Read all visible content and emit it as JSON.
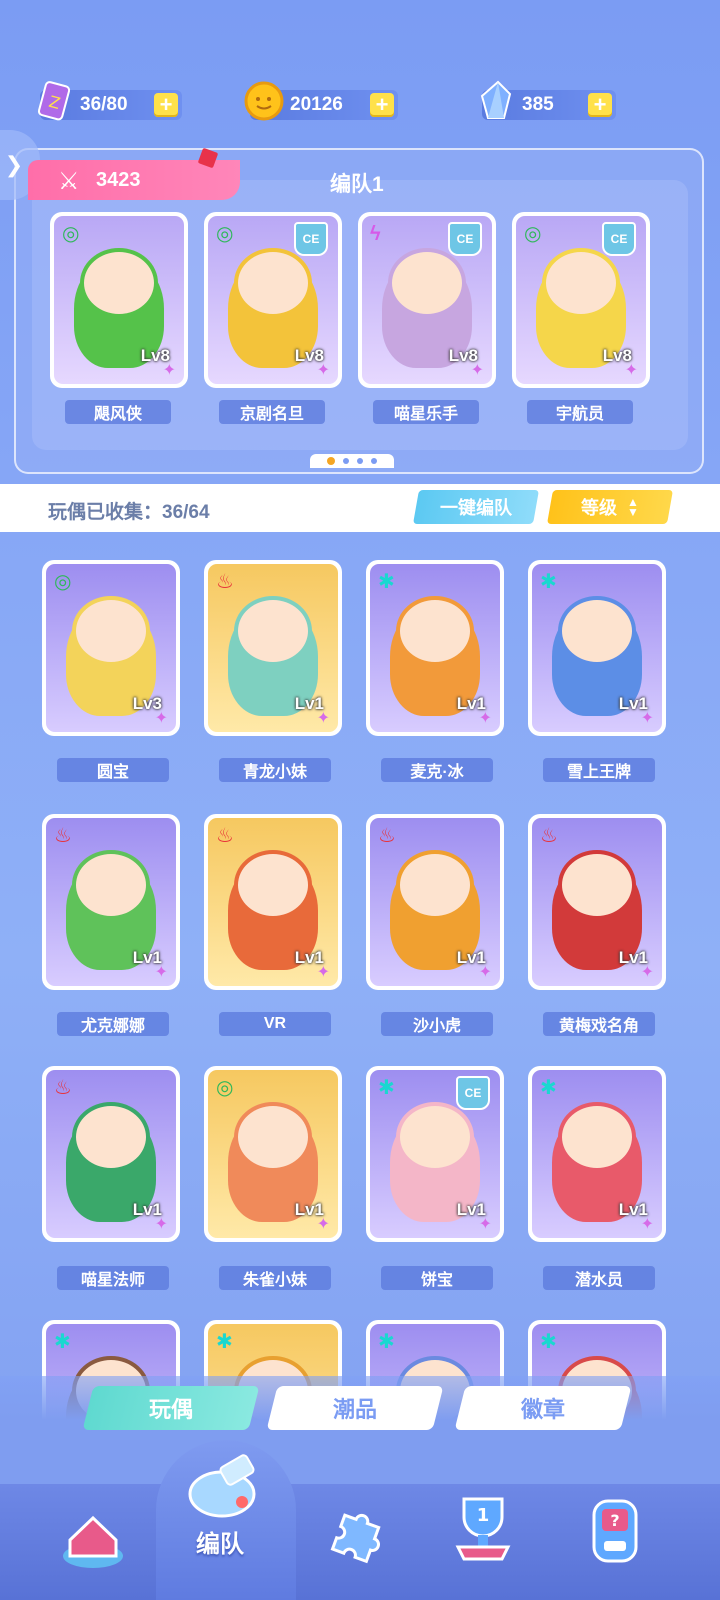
{
  "resources": {
    "stamina": {
      "value": "36/80",
      "icon": "energy-ticket-icon"
    },
    "coins": {
      "value": "20126",
      "icon": "coin-icon"
    },
    "gems": {
      "value": "385",
      "icon": "crystal-icon"
    }
  },
  "team": {
    "power": "3423",
    "title": "编队1",
    "members": [
      {
        "name": "飓风侠",
        "level": "Lv8",
        "element": "wind",
        "ce": false,
        "color": "#55c24a"
      },
      {
        "name": "京剧名旦",
        "level": "Lv8",
        "element": "wind",
        "ce": true,
        "color": "#f3c33a"
      },
      {
        "name": "喵星乐手",
        "level": "Lv8",
        "element": "thunder",
        "ce": true,
        "color": "#c7a6e0"
      },
      {
        "name": "宇航员",
        "level": "Lv8",
        "element": "wind",
        "ce": true,
        "color": "#f5d64a"
      }
    ],
    "page_count": 4,
    "active_page": 1
  },
  "collection": {
    "label": "玩偶已收集：36/64",
    "one_click_label": "一键编队",
    "sort_label": "等级"
  },
  "dolls": [
    {
      "name": "圆宝",
      "level": "Lv3",
      "element": "wind",
      "ce": false,
      "color": "#f3d35a"
    },
    {
      "name": "青龙小妹",
      "level": "Lv1",
      "element": "fire",
      "ce": false,
      "color": "#7ed0c0"
    },
    {
      "name": "麦克·冰",
      "level": "Lv1",
      "element": "ice",
      "ce": false,
      "color": "#f29a3a"
    },
    {
      "name": "雪上王牌",
      "level": "Lv1",
      "element": "ice",
      "ce": false,
      "color": "#5c8ee6"
    },
    {
      "name": "尤克娜娜",
      "level": "Lv1",
      "element": "fire",
      "ce": false,
      "color": "#5fc25a"
    },
    {
      "name": "VR",
      "level": "Lv1",
      "element": "fire",
      "ce": false,
      "color": "#e86a3a"
    },
    {
      "name": "沙小虎",
      "level": "Lv1",
      "element": "fire",
      "ce": false,
      "color": "#f0a030"
    },
    {
      "name": "黄梅戏名角",
      "level": "Lv1",
      "element": "fire",
      "ce": false,
      "color": "#d23a3a"
    },
    {
      "name": "喵星法师",
      "level": "Lv1",
      "element": "fire",
      "ce": false,
      "color": "#3aa86a"
    },
    {
      "name": "朱雀小妹",
      "level": "Lv1",
      "element": "wind",
      "ce": false,
      "color": "#f08a5a"
    },
    {
      "name": "饼宝",
      "level": "Lv1",
      "element": "ice",
      "ce": true,
      "color": "#f4b6c8"
    },
    {
      "name": "潜水员",
      "level": "Lv1",
      "element": "ice",
      "ce": false,
      "color": "#e85a6a"
    },
    {
      "name": "",
      "level": "",
      "element": "ice",
      "ce": false,
      "color": "#8a5a40"
    },
    {
      "name": "",
      "level": "",
      "element": "ice",
      "ce": false,
      "color": "#e8a030"
    },
    {
      "name": "",
      "level": "",
      "element": "ice",
      "ce": false,
      "color": "#6a8ae0"
    },
    {
      "name": "",
      "level": "",
      "element": "ice",
      "ce": false,
      "color": "#d84a4a"
    }
  ],
  "tabs": [
    {
      "label": "玩偶",
      "active": true
    },
    {
      "label": "潮品",
      "active": false
    },
    {
      "label": "徽章",
      "active": false
    }
  ],
  "nav": {
    "items": [
      {
        "icon": "home-icon"
      },
      {
        "icon": "team-whistle-icon",
        "label": "编队"
      },
      {
        "icon": "puzzle-icon"
      },
      {
        "icon": "trophy-icon"
      },
      {
        "icon": "gacha-machine-icon"
      }
    ]
  },
  "ce_badge": "CE"
}
